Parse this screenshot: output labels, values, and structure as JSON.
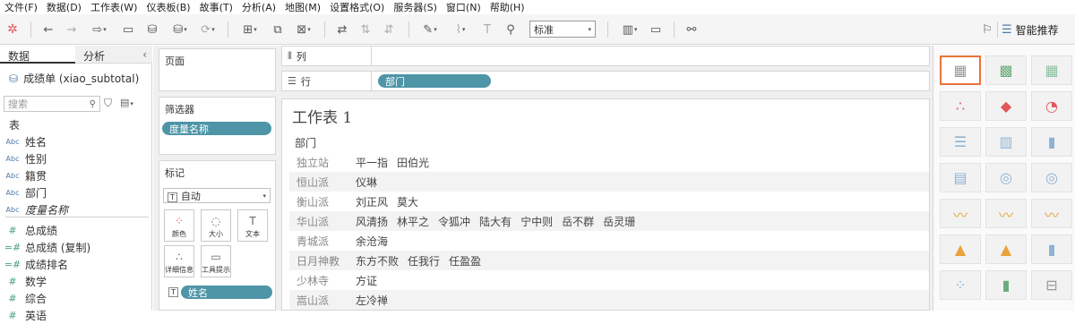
{
  "menu": [
    "文件(F)",
    "数据(D)",
    "工作表(W)",
    "仪表板(B)",
    "故事(T)",
    "分析(A)",
    "地图(M)",
    "设置格式(O)",
    "服务器(S)",
    "窗口(N)",
    "帮助(H)"
  ],
  "toolbar": {
    "fit_value": "标准",
    "smart_label": "智能推荐",
    "icons": [
      "tableau-logo-icon",
      "undo-icon",
      "redo-icon",
      "replay-icon",
      "save-icon",
      "new-datasource-icon",
      "pause-updates-icon",
      "refresh-icon",
      "new-worksheet-icon",
      "duplicate-sheet-icon",
      "clear-sheet-icon",
      "swap-icon",
      "sort-asc-icon",
      "sort-desc-icon",
      "highlight-icon",
      "group-icon",
      "label-icon",
      "pin-icon",
      "fit-icon",
      "presentation-icon",
      "share-icon",
      "showme-pin-icon"
    ]
  },
  "left": {
    "tab_data": "数据",
    "tab_analysis": "分析",
    "datasource": "成绩单 (xiao_subtotal)",
    "search_placeholder": "搜索",
    "table_heading": "表",
    "fields": [
      {
        "type": "Abc",
        "name": "姓名"
      },
      {
        "type": "Abc",
        "name": "性别"
      },
      {
        "type": "Abc",
        "name": "籍贯"
      },
      {
        "type": "Abc",
        "name": "部门"
      },
      {
        "type": "Abc",
        "name": "度量名称"
      },
      {
        "type": "#",
        "name": "总成绩"
      },
      {
        "type": "=#",
        "name": "总成绩 (复制)"
      },
      {
        "type": "=#",
        "name": "成绩排名"
      },
      {
        "type": "#",
        "name": "数学"
      },
      {
        "type": "#",
        "name": "综合"
      },
      {
        "type": "#",
        "name": "英语"
      }
    ]
  },
  "cards": {
    "pages_title": "页面",
    "filters_title": "筛选器",
    "filter_pill": "度量名称",
    "marks_title": "标记",
    "mark_type": "自动",
    "mark_buttons": [
      "颜色",
      "大小",
      "文本",
      "详细信息",
      "工具提示"
    ],
    "mark_pill": "姓名"
  },
  "shelves": {
    "columns_label": "列",
    "rows_label": "行",
    "rows_pill": "部门"
  },
  "sheet": {
    "title": "工作表 1",
    "column_header": "部门",
    "rows": [
      {
        "dept": "独立站",
        "names": [
          "平一指",
          "田伯光"
        ]
      },
      {
        "dept": "恒山派",
        "names": [
          "仪琳"
        ]
      },
      {
        "dept": "衡山派",
        "names": [
          "刘正风",
          "莫大"
        ]
      },
      {
        "dept": "华山派",
        "names": [
          "风清扬",
          "林平之",
          "令狐冲",
          "陆大有",
          "宁中则",
          "岳不群",
          "岳灵珊"
        ]
      },
      {
        "dept": "青城派",
        "names": [
          "余沧海"
        ]
      },
      {
        "dept": "日月神教",
        "names": [
          "东方不败",
          "任我行",
          "任盈盈"
        ]
      },
      {
        "dept": "少林寺",
        "names": [
          "方证"
        ]
      },
      {
        "dept": "嵩山派",
        "names": [
          "左冷禅"
        ]
      }
    ]
  },
  "colors": {
    "pill": "#4e95a7",
    "selected_thumb": "#e8743b",
    "background": "#f0f0f0"
  }
}
